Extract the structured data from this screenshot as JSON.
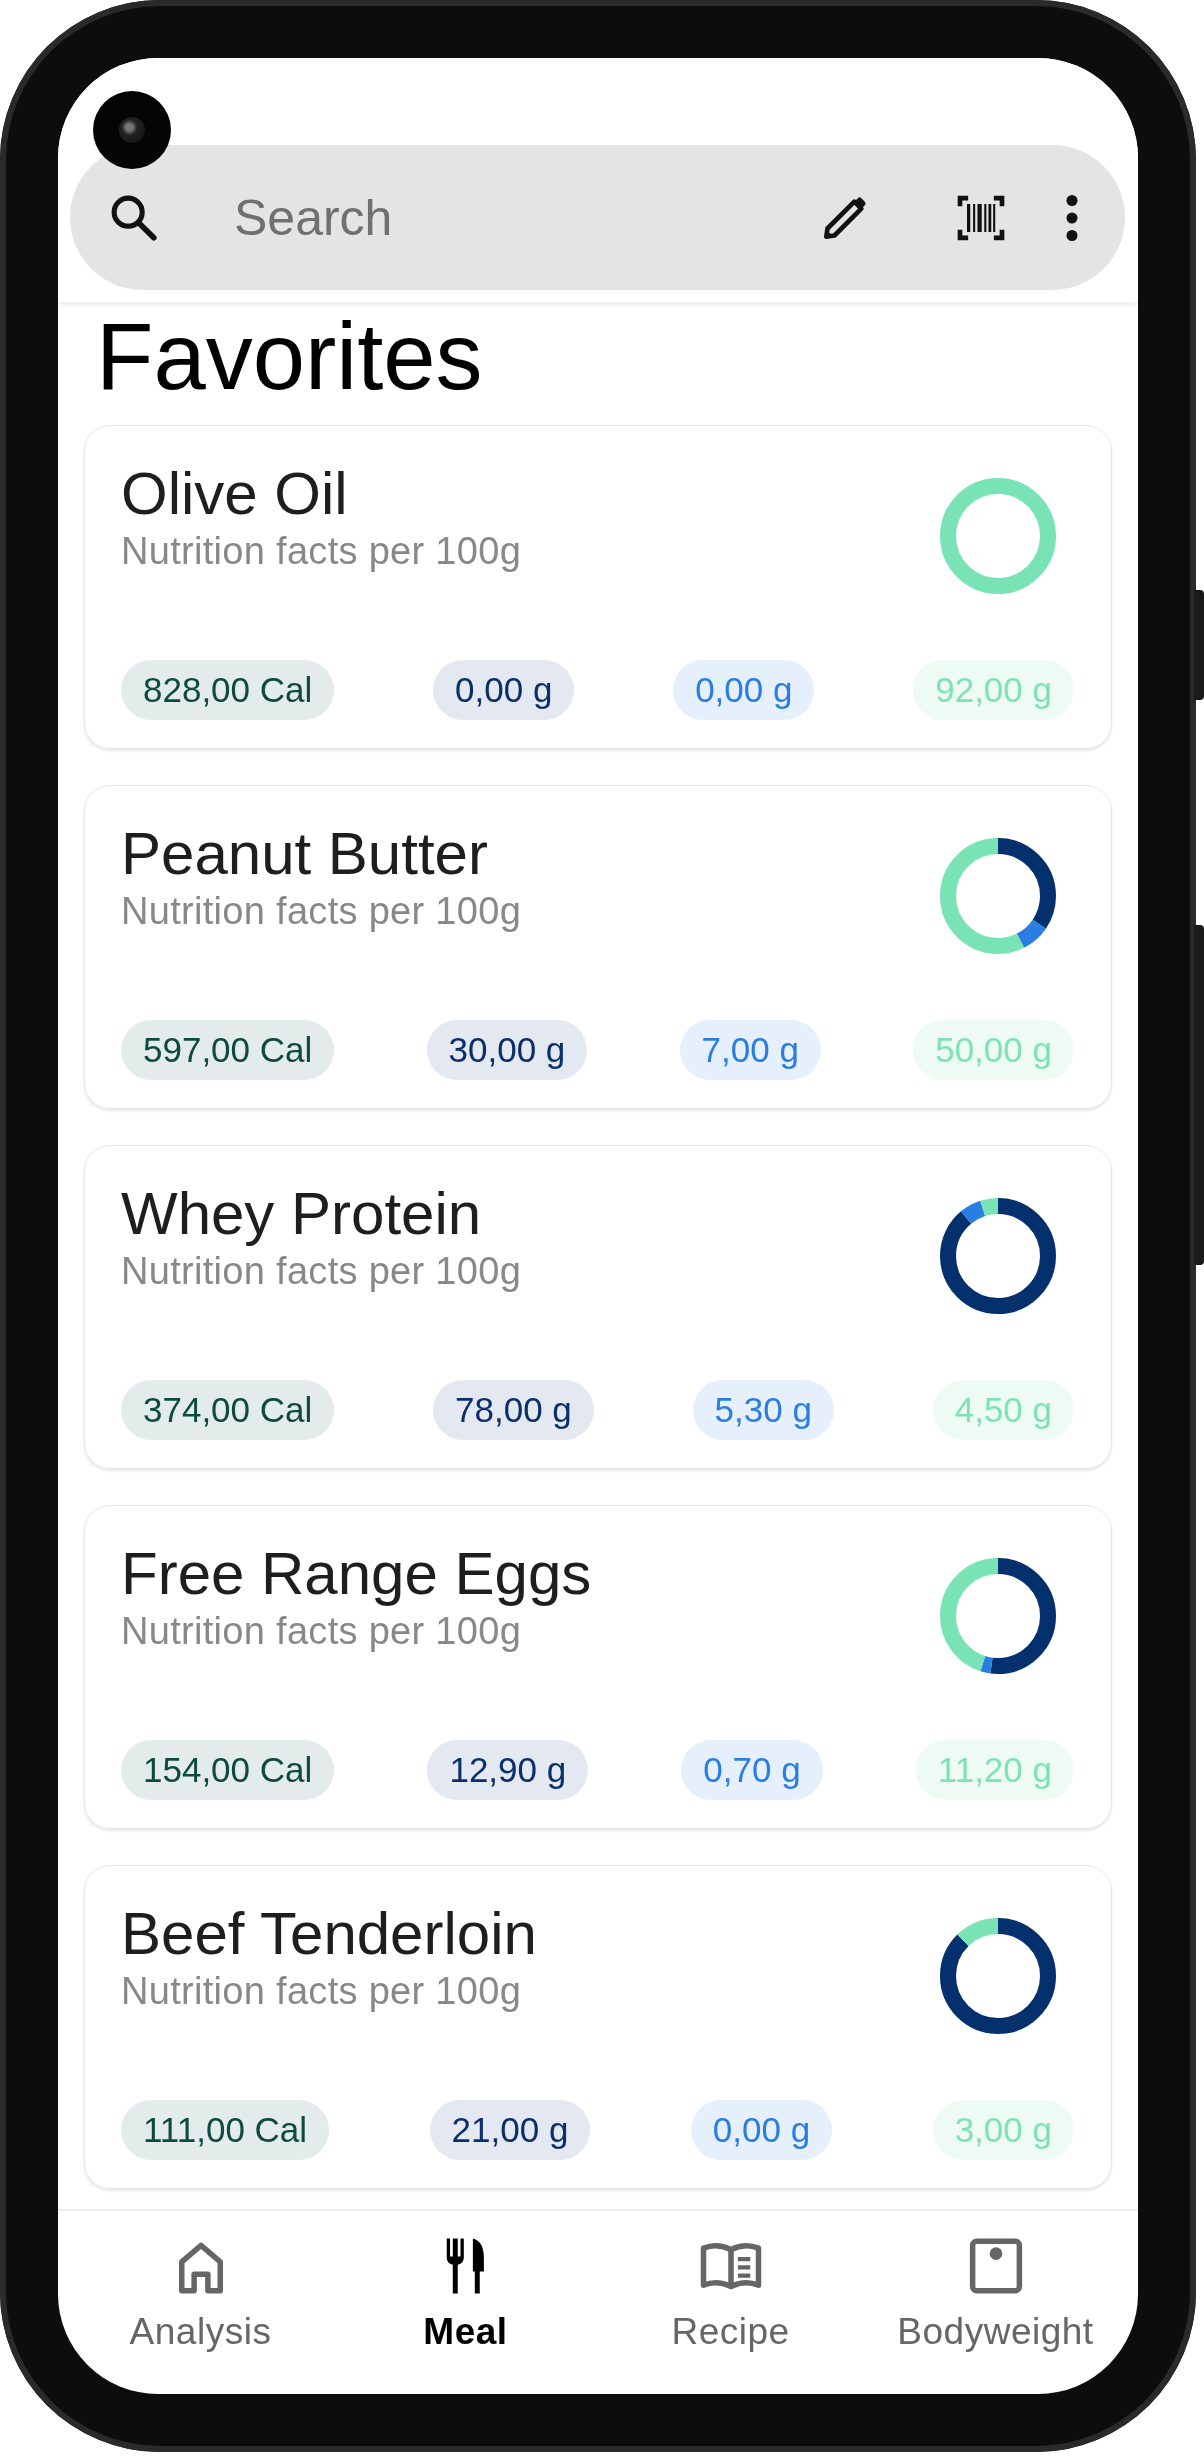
{
  "search": {
    "placeholder": "Search"
  },
  "title": "Favorites",
  "foods": [
    {
      "name": "Olive Oil",
      "subtitle": "Nutrition facts per 100g",
      "nutrients": [
        {
          "kind": "calories",
          "value": "828,00 Cal"
        },
        {
          "kind": "protein",
          "value": "0,00 g"
        },
        {
          "kind": "carbs",
          "value": "0,00 g"
        },
        {
          "kind": "fat",
          "value": "92,00 g"
        }
      ]
    },
    {
      "name": "Peanut Butter",
      "subtitle": "Nutrition facts per 100g",
      "nutrients": [
        {
          "kind": "calories",
          "value": "597,00 Cal"
        },
        {
          "kind": "protein",
          "value": "30,00 g"
        },
        {
          "kind": "carbs",
          "value": "7,00 g"
        },
        {
          "kind": "fat",
          "value": "50,00 g"
        }
      ]
    },
    {
      "name": "Whey Protein",
      "subtitle": "Nutrition facts per 100g",
      "nutrients": [
        {
          "kind": "calories",
          "value": "374,00 Cal"
        },
        {
          "kind": "protein",
          "value": "78,00 g"
        },
        {
          "kind": "carbs",
          "value": "5,30 g"
        },
        {
          "kind": "fat",
          "value": "4,50 g"
        }
      ]
    },
    {
      "name": "Free Range Eggs",
      "subtitle": "Nutrition facts per 100g",
      "nutrients": [
        {
          "kind": "calories",
          "value": "154,00 Cal"
        },
        {
          "kind": "protein",
          "value": "12,90 g"
        },
        {
          "kind": "carbs",
          "value": "0,70 g"
        },
        {
          "kind": "fat",
          "value": "11,20 g"
        }
      ]
    },
    {
      "name": "Beef Tenderloin",
      "subtitle": "Nutrition facts per 100g",
      "nutrients": [
        {
          "kind": "calories",
          "value": "111,00 Cal"
        },
        {
          "kind": "protein",
          "value": "21,00 g"
        },
        {
          "kind": "carbs",
          "value": "0,00 g"
        },
        {
          "kind": "fat",
          "value": "3,00 g"
        }
      ]
    }
  ],
  "nav": [
    {
      "kind": "home",
      "label": "Analysis",
      "selected": false
    },
    {
      "kind": "meal",
      "label": "Meal",
      "selected": true
    },
    {
      "kind": "book",
      "label": "Recipe",
      "selected": false
    },
    {
      "kind": "scale",
      "label": "Bodyweight",
      "selected": false
    }
  ]
}
